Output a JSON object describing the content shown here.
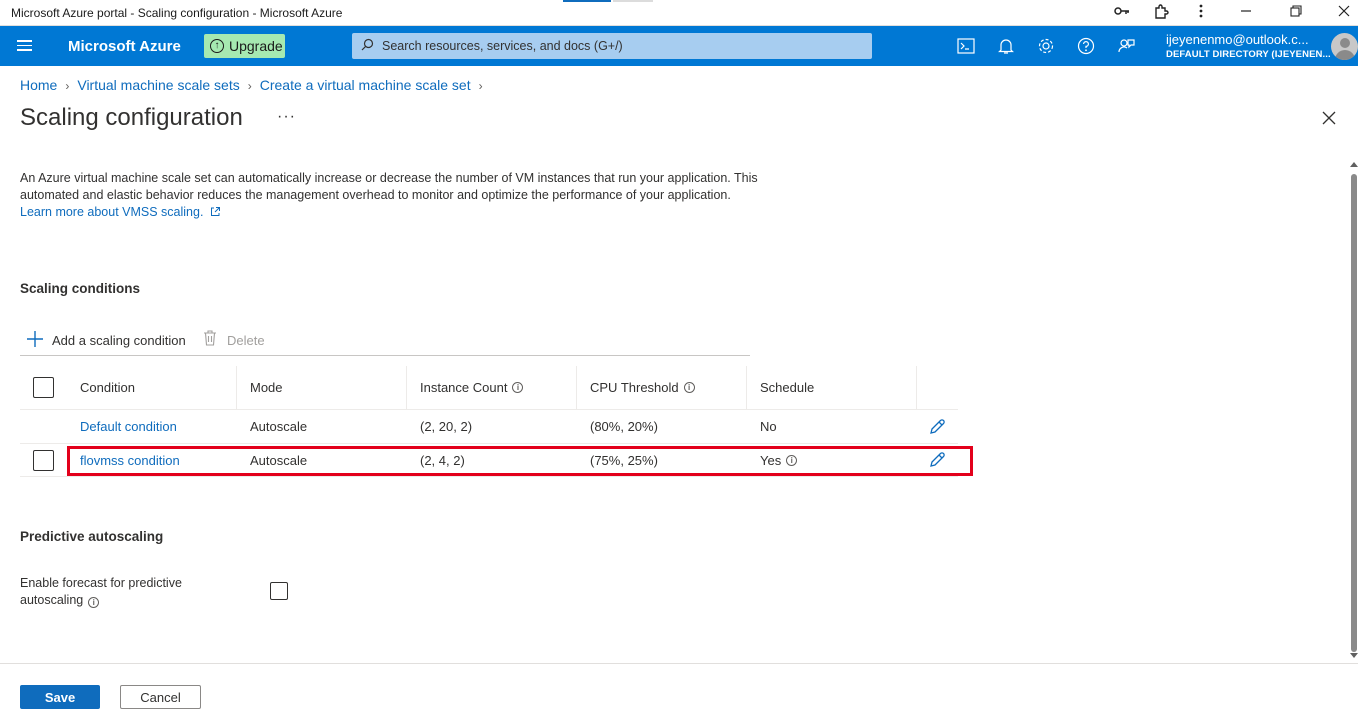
{
  "window": {
    "title": "Microsoft Azure portal - Scaling configuration - Microsoft Azure"
  },
  "topbar": {
    "brand": "Microsoft Azure",
    "upgrade_label": "Upgrade",
    "search_placeholder": "Search resources, services, and docs (G+/)",
    "icons": [
      "cloud-shell-icon",
      "notifications-icon",
      "settings-icon",
      "help-icon",
      "feedback-icon"
    ],
    "user_email": "ijeyenenmo@outlook.c...",
    "user_directory": "DEFAULT DIRECTORY (IJEYENEN..."
  },
  "breadcrumb": [
    "Home",
    "Virtual machine scale sets",
    "Create a virtual machine scale set"
  ],
  "page": {
    "title": "Scaling configuration",
    "more": "···",
    "description": "An Azure virtual machine scale set can automatically increase or decrease the number of VM instances that run your application. This automated and elastic behavior reduces the management overhead to monitor and optimize the performance of your application.",
    "learn_more": "Learn more about VMSS scaling."
  },
  "scaling_conditions": {
    "title": "Scaling conditions",
    "add_label": "Add a scaling condition",
    "delete_label": "Delete",
    "columns": [
      "Condition",
      "Mode",
      "Instance Count",
      "CPU Threshold",
      "Schedule"
    ],
    "rows": [
      {
        "condition": "Default condition",
        "mode": "Autoscale",
        "instance_count": "(2, 20, 2)",
        "cpu_threshold": "(80%, 20%)",
        "schedule": "No",
        "has_checkbox": false
      },
      {
        "condition": "flovmss condition",
        "mode": "Autoscale",
        "instance_count": "(2, 4, 2)",
        "cpu_threshold": "(75%, 25%)",
        "schedule": "Yes",
        "has_checkbox": true
      }
    ]
  },
  "predictive": {
    "title": "Predictive autoscaling",
    "forecast_label": "Enable forecast for predictive autoscaling",
    "forecast_enabled": false
  },
  "footer": {
    "save_label": "Save",
    "cancel_label": "Cancel"
  },
  "colors": {
    "accent": "#0078d4",
    "link": "#0f6cbd",
    "highlight": "#e3001b",
    "upgrade": "#a6e9b1"
  }
}
